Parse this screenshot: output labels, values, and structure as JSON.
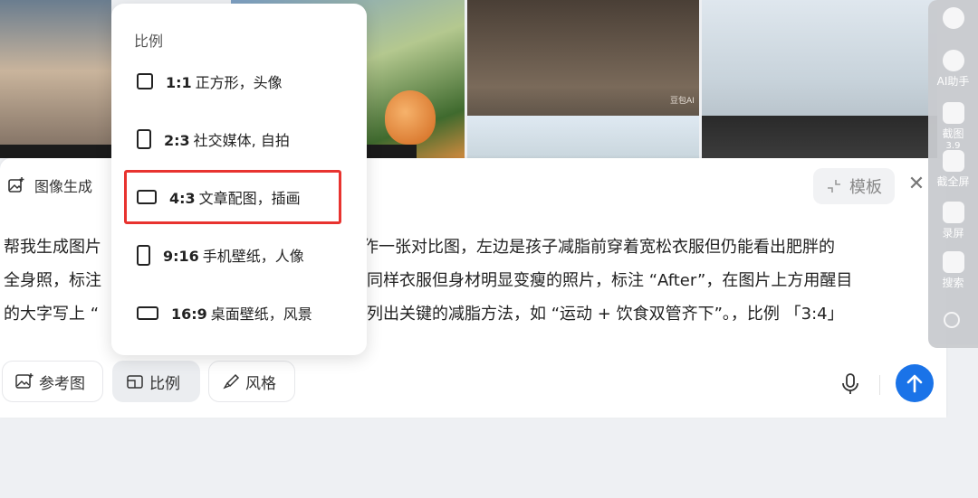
{
  "card": {
    "header_label": "图像生成",
    "template_label": "模板",
    "prompt_text": "帮我生成图片：制作一张对比图，左边是孩子减脂前穿着宽松衣服但仍能看出肥胖的全身照，标注 “Before”；右边是同样衣服但身材明显变瘦的照片，标注 “After”，在图片上方用醒目的大字写上 “减脂前后对比”，下方列出关键的减脂方法，如 “运动 + 饮食双管齐下”。，比例 「3:4」",
    "prompt_lines": [
      "帮我生成图片",
      "全身照，标注",
      "的大字写上 “",
      "作一张对比图，左边是孩子减脂前穿着宽松衣服但仍能看出肥胖的",
      "同样衣服但身材明显变瘦的照片，标注 “After”，在图片上方用醒目",
      "列出关键的减脂方法，如 “运动 + 饮食双管齐下”。，比例 「3:4」"
    ],
    "chips": {
      "reference": "参考图",
      "ratio": "比例",
      "style": "风格"
    }
  },
  "ratio_menu": {
    "title": "比例",
    "options": [
      {
        "ratio": "1:1",
        "desc": "正方形，头像"
      },
      {
        "ratio": "2:3",
        "desc": "社交媒体, 自拍"
      },
      {
        "ratio": "4:3",
        "desc": "文章配图，插画"
      },
      {
        "ratio": "9:16",
        "desc": "手机壁纸，人像"
      },
      {
        "ratio": "16:9",
        "desc": "桌面壁纸，风景"
      }
    ],
    "highlighted": "4:3"
  },
  "gallery": {
    "watermark": "豆包AI"
  },
  "side_toolbar": {
    "items": [
      {
        "label": "AI助手",
        "icon": "ai-assistant-icon"
      },
      {
        "label": "截图",
        "icon": "screenshot-icon"
      },
      {
        "label": "截全屏",
        "icon": "fullscreen-capture-icon"
      },
      {
        "label": "录屏",
        "icon": "record-screen-icon"
      },
      {
        "label": "搜索",
        "icon": "search-icon"
      }
    ],
    "badge": "3.9"
  },
  "colors": {
    "accent": "#1a73e8",
    "highlight": "#e8332f"
  }
}
